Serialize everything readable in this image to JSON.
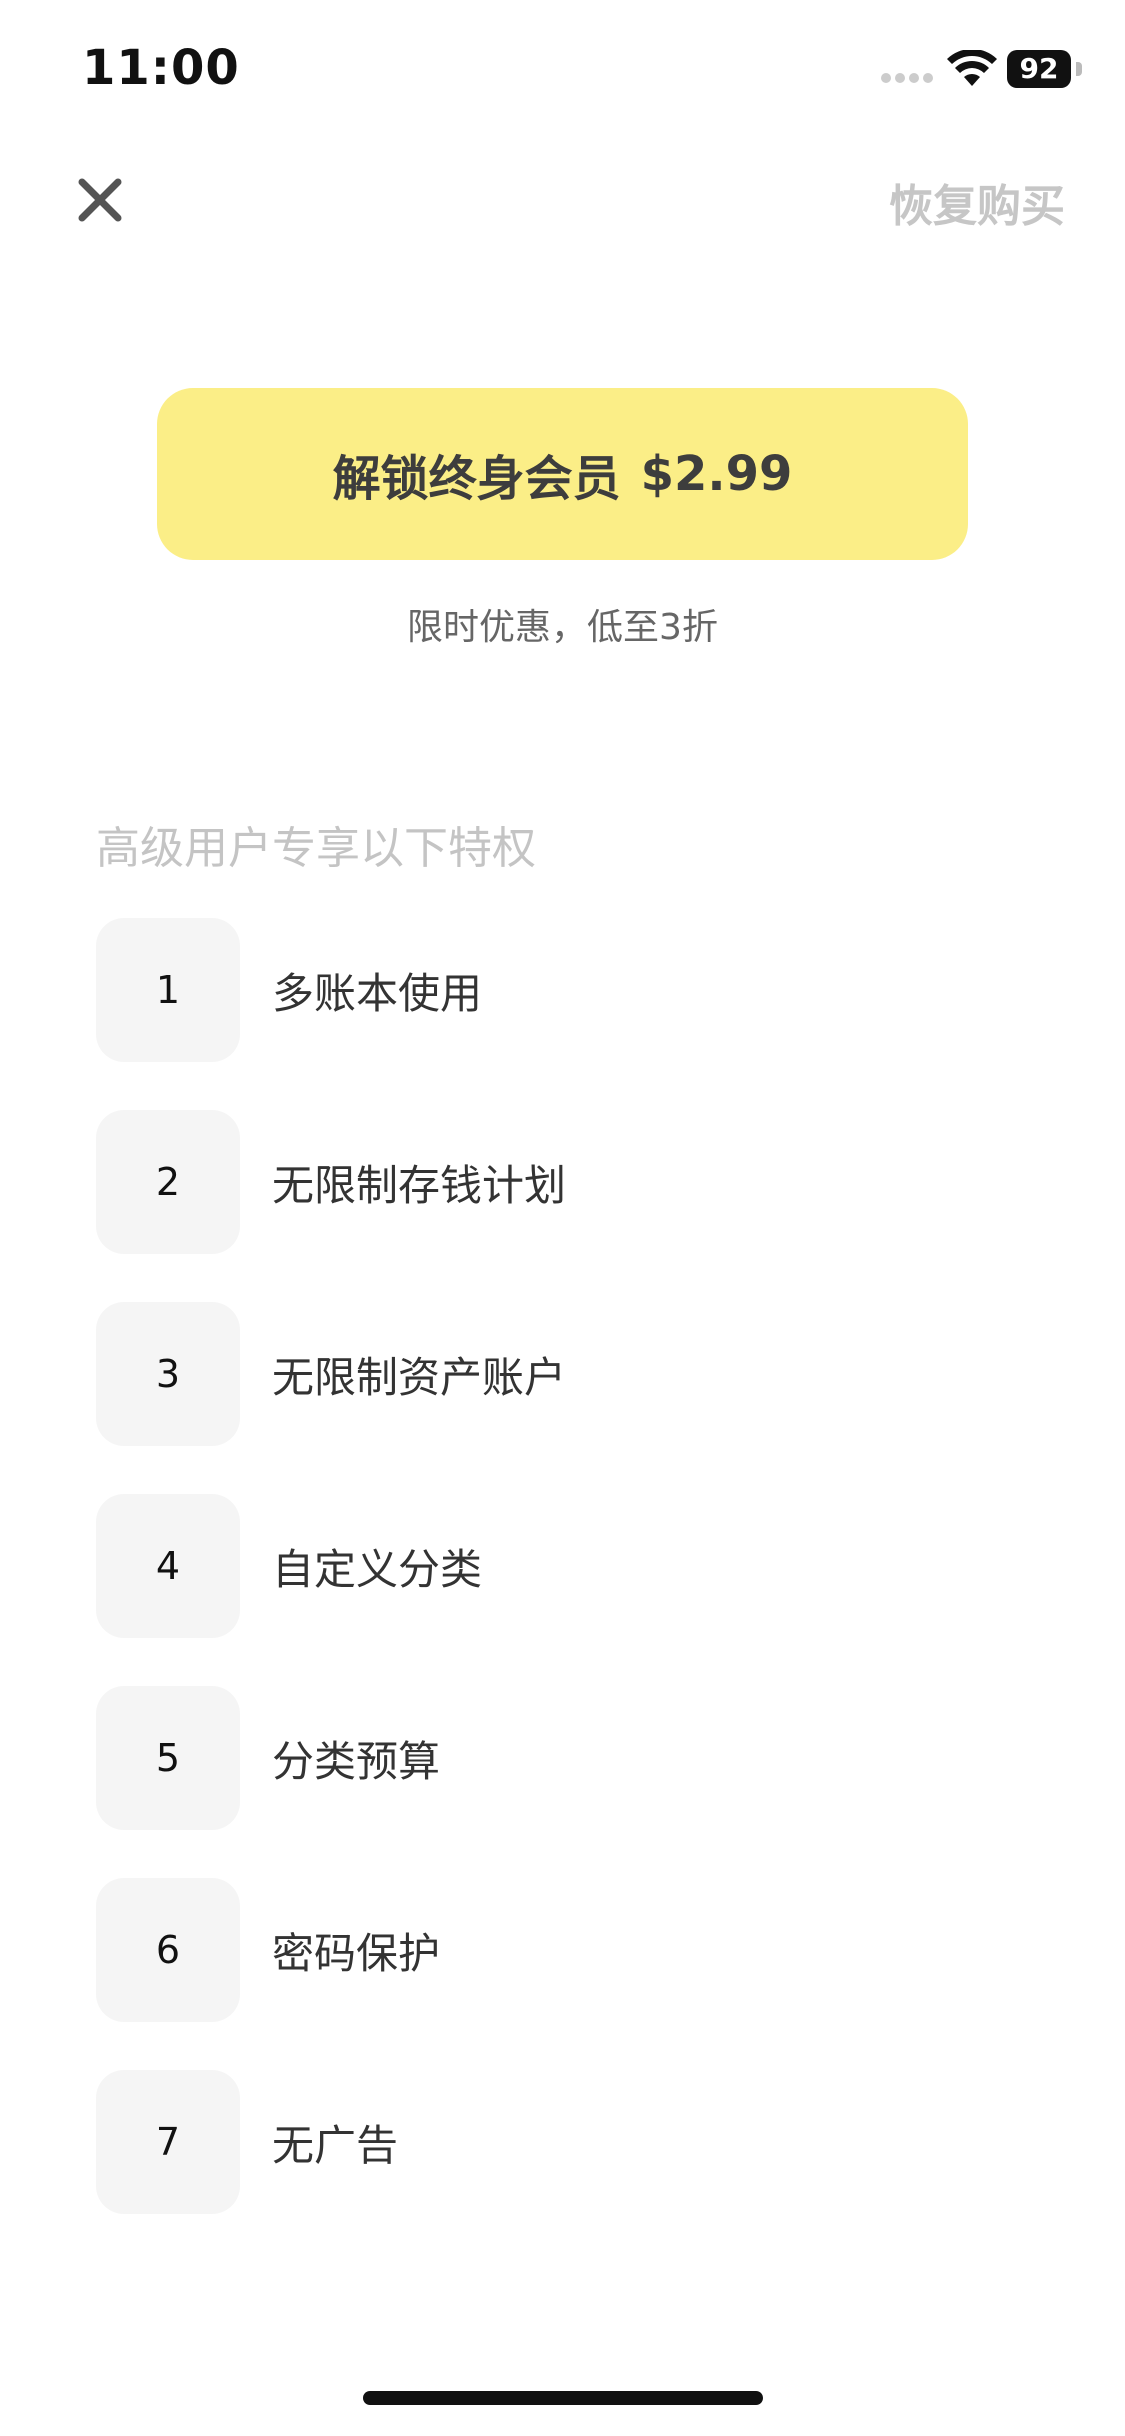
{
  "status_bar": {
    "time": "11:00",
    "battery": "92"
  },
  "nav": {
    "close_icon": "close-icon",
    "restore_label": "恢复购买"
  },
  "unlock": {
    "label": "解锁终身会员",
    "price": "$2.99",
    "promo": "限时优惠，低至3折"
  },
  "features": {
    "heading": "高级用户专享以下特权",
    "items": [
      {
        "num": "1",
        "label": "多账本使用"
      },
      {
        "num": "2",
        "label": "无限制存钱计划"
      },
      {
        "num": "3",
        "label": "无限制资产账户"
      },
      {
        "num": "4",
        "label": "自定义分类"
      },
      {
        "num": "5",
        "label": "分类预算"
      },
      {
        "num": "6",
        "label": "密码保护"
      },
      {
        "num": "7",
        "label": "无广告"
      }
    ]
  },
  "colors": {
    "accent": "#fbee87",
    "muted_text": "#c4c4c4",
    "tile_bg": "#f5f5f5"
  }
}
